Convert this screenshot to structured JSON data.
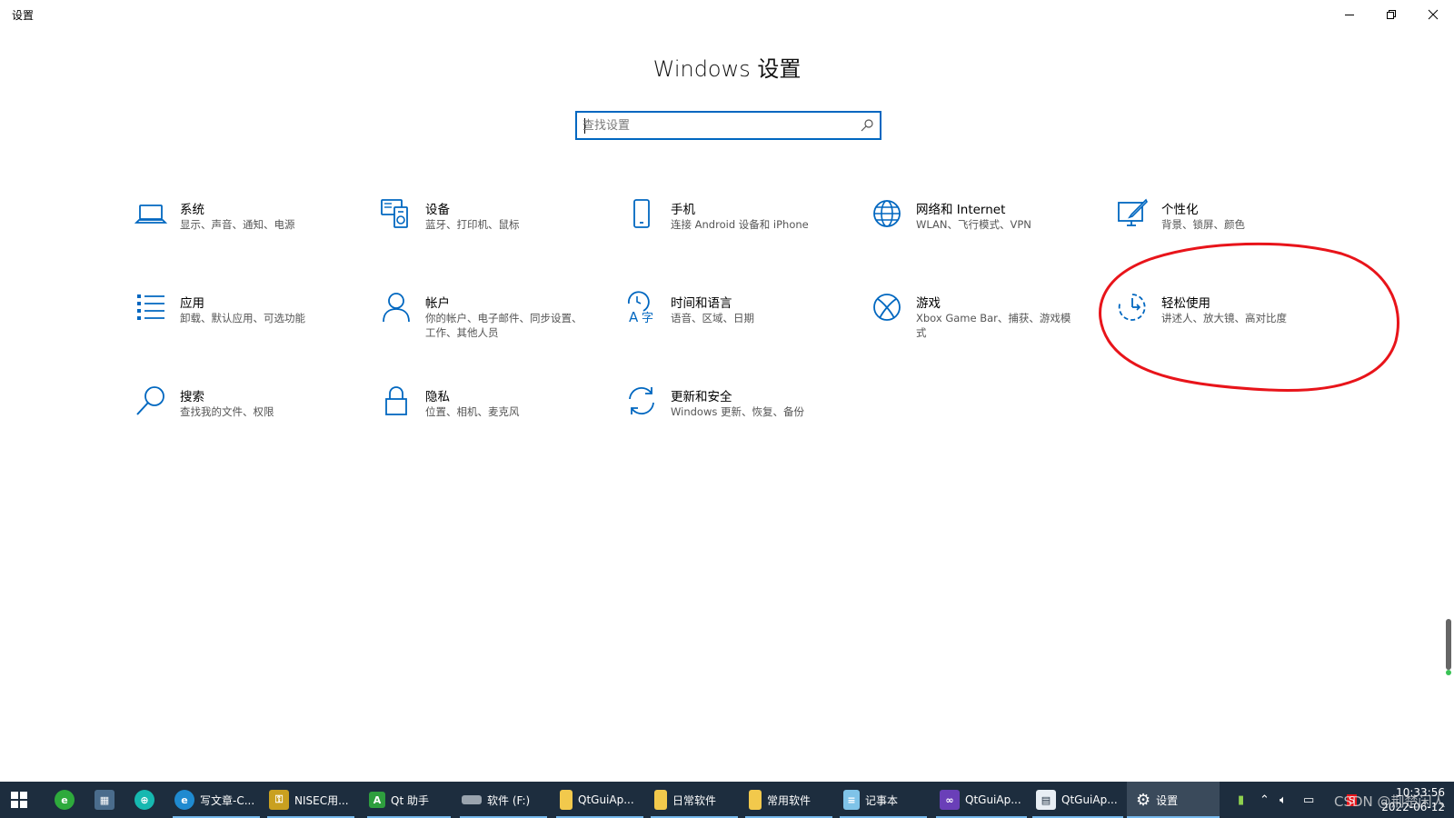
{
  "window": {
    "title": "设置",
    "controls": {
      "minimize": "minimize-icon",
      "maximize": "restore-icon",
      "close": "close-icon"
    }
  },
  "header": {
    "title": "Windows 设置"
  },
  "search": {
    "placeholder": "查找设置",
    "value": ""
  },
  "tiles": [
    {
      "name": "系统",
      "desc": "显示、声音、通知、电源",
      "icon": "laptop-icon"
    },
    {
      "name": "设备",
      "desc": "蓝牙、打印机、鼠标",
      "icon": "devices-icon"
    },
    {
      "name": "手机",
      "desc": "连接 Android 设备和 iPhone",
      "icon": "phone-icon"
    },
    {
      "name": "网络和 Internet",
      "desc": "WLAN、飞行模式、VPN",
      "icon": "globe-icon"
    },
    {
      "name": "个性化",
      "desc": "背景、锁屏、颜色",
      "icon": "paint-icon"
    },
    {
      "name": "应用",
      "desc": "卸载、默认应用、可选功能",
      "icon": "apps-list-icon"
    },
    {
      "name": "帐户",
      "desc": "你的帐户、电子邮件、同步设置、工作、其他人员",
      "icon": "person-icon"
    },
    {
      "name": "时间和语言",
      "desc": "语音、区域、日期",
      "icon": "time-language-icon"
    },
    {
      "name": "游戏",
      "desc": "Xbox Game Bar、捕获、游戏模式",
      "icon": "xbox-icon"
    },
    {
      "name": "轻松使用",
      "desc": "讲述人、放大镜、高对比度",
      "icon": "ease-of-access-icon"
    },
    {
      "name": "搜索",
      "desc": "查找我的文件、权限",
      "icon": "search-icon"
    },
    {
      "name": "隐私",
      "desc": "位置、相机、麦克风",
      "icon": "lock-icon"
    },
    {
      "name": "更新和安全",
      "desc": "Windows 更新、恢复、备份",
      "icon": "sync-icon"
    }
  ],
  "colors": {
    "accent": "#0067c0",
    "annotation": "#e8141a",
    "taskbar": "#1d2d3e"
  },
  "taskbar": {
    "pinned": [
      {
        "label": "",
        "icon": "start-icon"
      },
      {
        "label": "",
        "icon": "browser-360-icon"
      },
      {
        "label": "",
        "icon": "calculator-icon"
      },
      {
        "label": "",
        "icon": "network-app-icon"
      }
    ],
    "apps": [
      {
        "label": "写文章-C...",
        "icon": "edge-icon"
      },
      {
        "label": "NISEC用...",
        "icon": "key-icon"
      },
      {
        "label": "Qt 助手",
        "icon": "qt-assistant-icon"
      },
      {
        "label": "软件 (F:)",
        "icon": "drive-icon"
      },
      {
        "label": "QtGuiAp...",
        "icon": "folder-icon"
      },
      {
        "label": "日常软件",
        "icon": "folder-icon"
      },
      {
        "label": "常用软件",
        "icon": "folder-icon"
      },
      {
        "label": "记事本",
        "icon": "notepad-icon"
      },
      {
        "label": "QtGuiAp...",
        "icon": "visual-studio-icon"
      },
      {
        "label": "QtGuiAp...",
        "icon": "app-window-icon"
      },
      {
        "label": "设置",
        "icon": "gear-icon"
      }
    ],
    "clock": {
      "time": "10:33:56",
      "date": "2022-06-12"
    },
    "watermark": "CSDN @荆楚闲人"
  }
}
